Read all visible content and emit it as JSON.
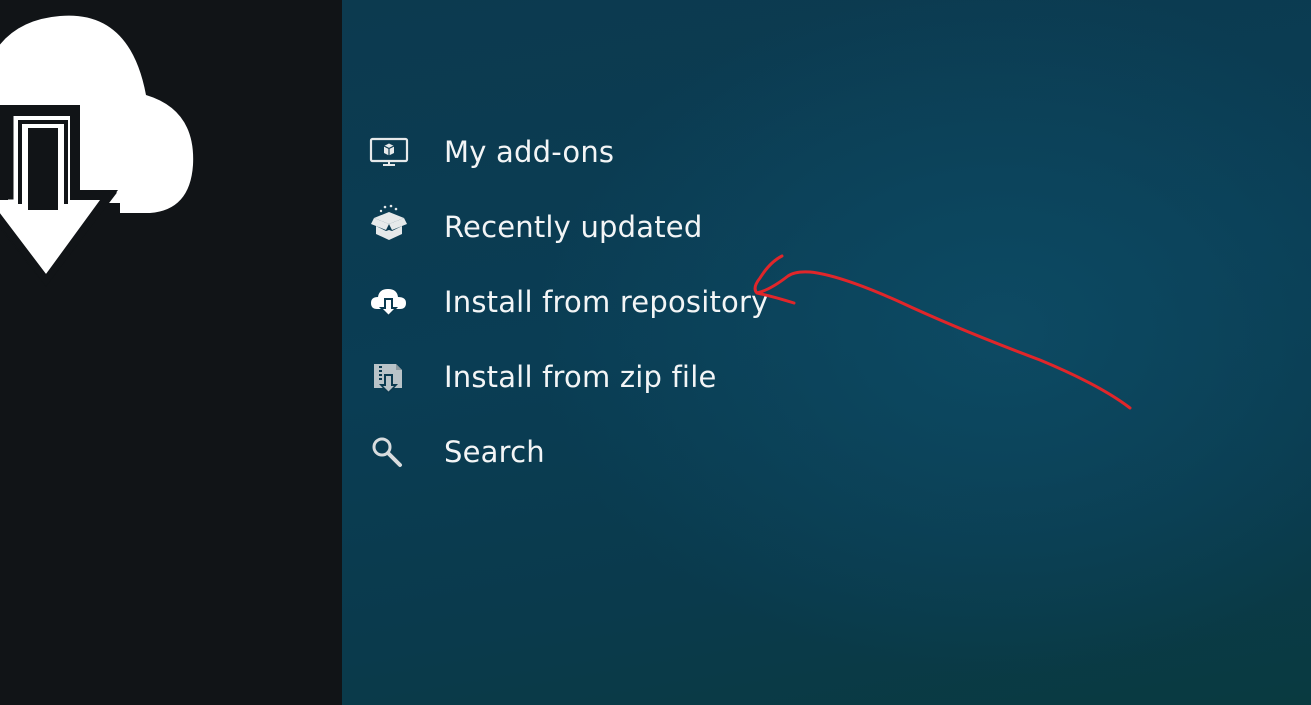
{
  "colors": {
    "sidebar_bg": "#111417",
    "main_bg": "#0b3a50",
    "text": "#f3f5f6",
    "icon": "#e6e9ea",
    "annotation": "#e0262a"
  },
  "sidebar": {
    "hero_icon": "cloud-download-icon"
  },
  "menu": {
    "items": [
      {
        "label": "My add-ons",
        "icon": "monitor-box-icon"
      },
      {
        "label": "Recently updated",
        "icon": "open-box-icon"
      },
      {
        "label": "Install from repository",
        "icon": "cloud-download-icon"
      },
      {
        "label": "Install from zip file",
        "icon": "zip-download-icon"
      },
      {
        "label": "Search",
        "icon": "magnifier-icon"
      }
    ]
  },
  "annotation": {
    "type": "hand-drawn-arrow",
    "points_to": "Install from repository"
  }
}
